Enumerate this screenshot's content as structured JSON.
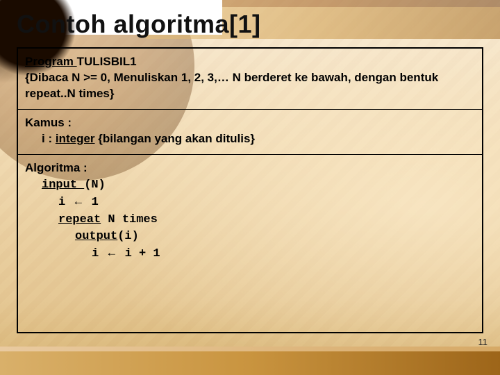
{
  "title": "Contoh algoritma[1]",
  "pagenum": "11",
  "program": {
    "label": "Program ",
    "name": "TULISBIL1",
    "desc": "{Dibaca N >= 0, Menuliskan 1, 2, 3,… N berderet ke bawah, dengan bentuk repeat..N times}"
  },
  "kamus": {
    "label": "Kamus :",
    "var": "i : ",
    "type": "integer",
    "comment": "  {bilangan yang akan ditulis}"
  },
  "algo": {
    "label": "Algoritma :",
    "l1a": "input ",
    "l1b": "(N)",
    "l2a": "i ",
    "l2arrow": "←",
    "l2b": " 1",
    "l3a": "repeat",
    "l3b": " N times",
    "l4a": "output",
    "l4b": "(i)",
    "l5a": "i ",
    "l5arrow": "←",
    "l5b": " i + 1"
  }
}
